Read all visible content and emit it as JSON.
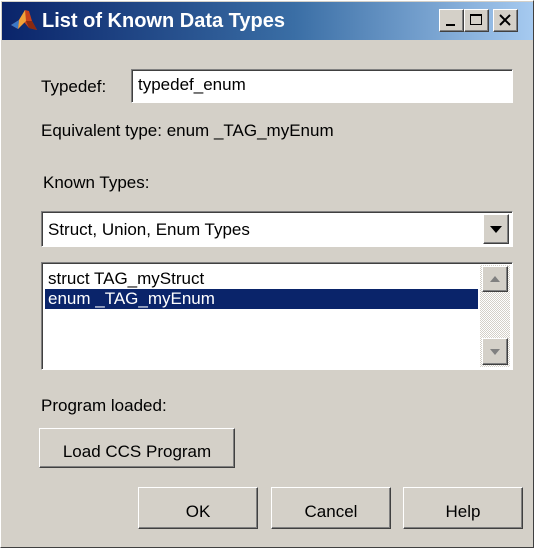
{
  "window": {
    "title": "List of Known Data Types",
    "controls": {
      "minimize_icon": "minimize-icon",
      "maximize_icon": "maximize-icon",
      "close_icon": "close-icon"
    }
  },
  "typedef": {
    "label": "Typedef:",
    "value": "typedef_enum"
  },
  "equivalent": {
    "text": "Equivalent type: enum _TAG_myEnum"
  },
  "known_types": {
    "label": "Known Types:",
    "selected": "Struct, Union, Enum Types",
    "items": [
      {
        "label": "struct TAG_myStruct",
        "selected": false
      },
      {
        "label": "enum _TAG_myEnum",
        "selected": true
      }
    ]
  },
  "program": {
    "label": "Program loaded:",
    "load_button": "Load CCS Program"
  },
  "buttons": {
    "ok": "OK",
    "cancel": "Cancel",
    "help": "Help"
  },
  "colors": {
    "title_bar_start": "#0a246a",
    "title_bar_end": "#a6caf0",
    "face": "#d4d0c8",
    "selection": "#0a246a"
  }
}
